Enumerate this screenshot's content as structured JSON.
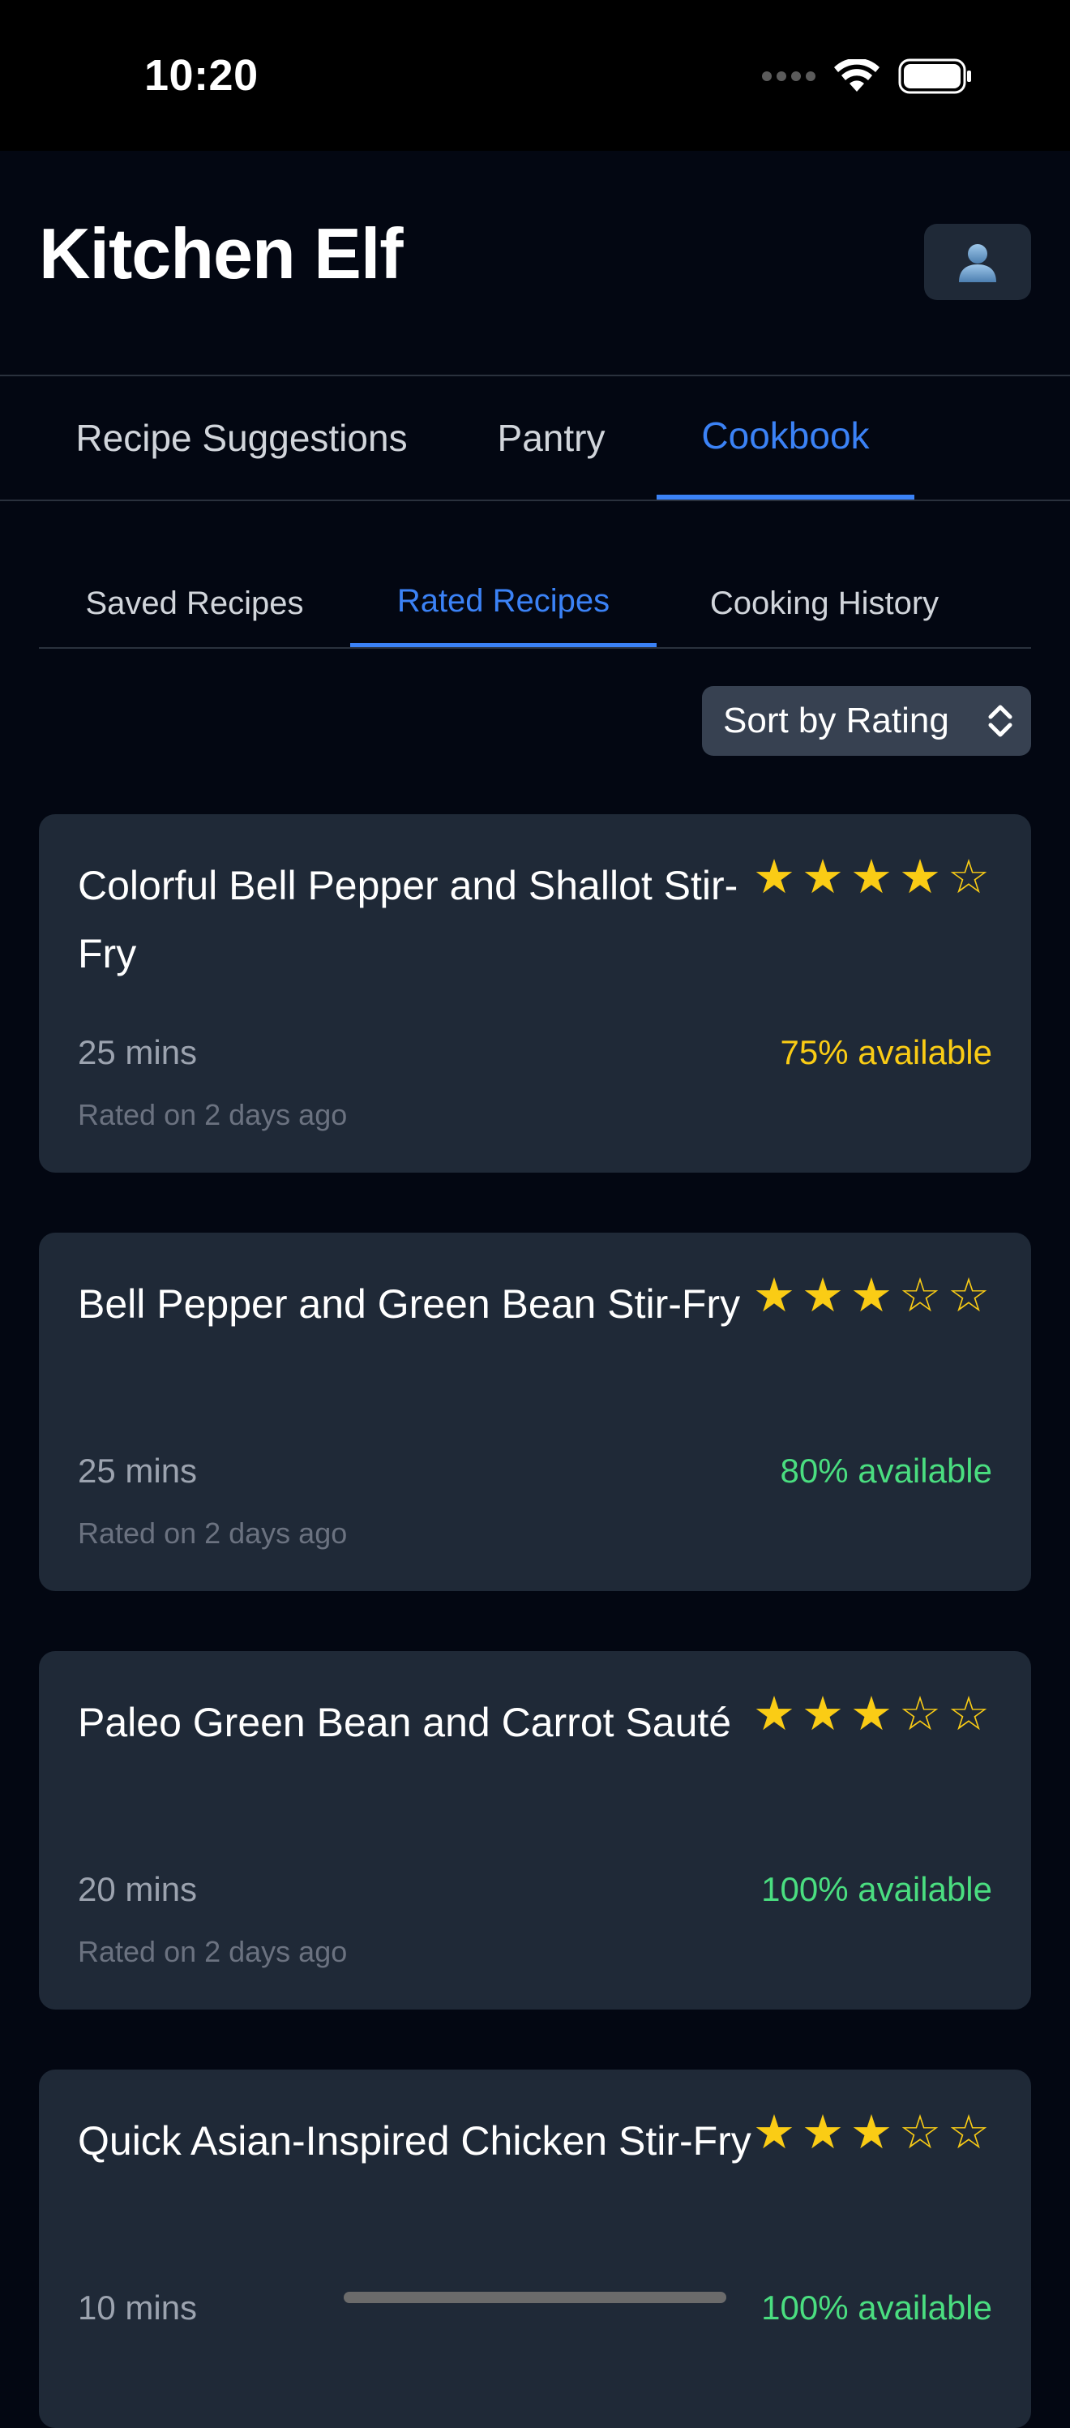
{
  "status_bar": {
    "time": "10:20"
  },
  "app": {
    "title": "Kitchen Elf",
    "profile_icon": "person-icon"
  },
  "main_tabs": [
    {
      "label": "Recipe Suggestions",
      "active": false
    },
    {
      "label": "Pantry",
      "active": false
    },
    {
      "label": "Cookbook",
      "active": true
    }
  ],
  "sub_tabs": [
    {
      "label": "Saved Recipes",
      "active": false
    },
    {
      "label": "Rated Recipes",
      "active": true
    },
    {
      "label": "Cooking History",
      "active": false
    }
  ],
  "sort": {
    "label": "Sort by Rating"
  },
  "colors": {
    "accent": "#3b82f6",
    "star": "#facc15",
    "available_warning": "#facc15",
    "available_good": "#4ade80"
  },
  "recipes": [
    {
      "title": "Colorful Bell Pepper and Shallot Stir-Fry",
      "rating": 4,
      "max_rating": 5,
      "time": "25 mins",
      "availability": "75% available",
      "availability_color": "#facc15",
      "rated": "Rated on 2 days ago"
    },
    {
      "title": "Bell Pepper and Green Bean Stir-Fry",
      "rating": 3,
      "max_rating": 5,
      "time": "25 mins",
      "availability": "80% available",
      "availability_color": "#4ade80",
      "rated": "Rated on 2 days ago"
    },
    {
      "title": "Paleo Green Bean and Carrot Sauté",
      "rating": 3,
      "max_rating": 5,
      "time": "20 mins",
      "availability": "100% available",
      "availability_color": "#4ade80",
      "rated": "Rated on 2 days ago"
    },
    {
      "title": "Quick Asian-Inspired Chicken Stir-Fry",
      "rating": 3,
      "max_rating": 5,
      "time": "10 mins",
      "availability": "100% available",
      "availability_color": "#4ade80",
      "rated": ""
    }
  ]
}
